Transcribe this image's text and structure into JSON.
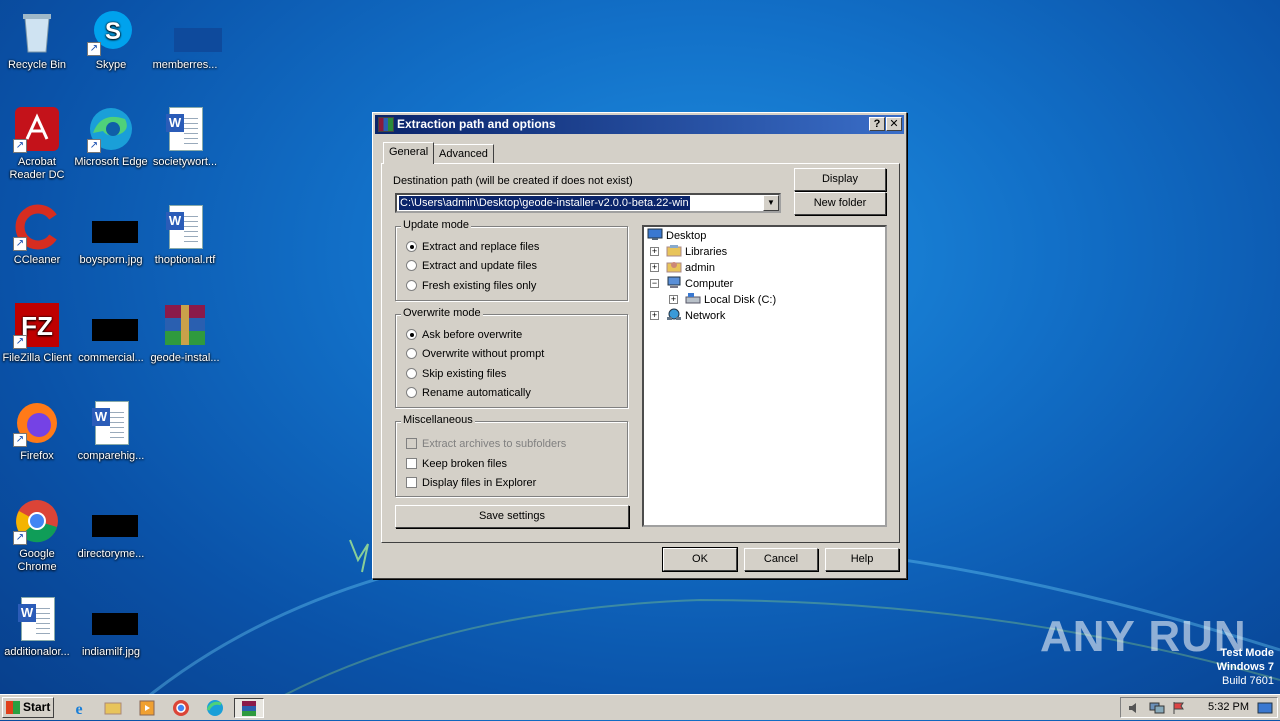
{
  "desktop": {
    "icons": [
      {
        "label": "Recycle Bin",
        "icon": "recycle-bin-icon"
      },
      {
        "label": "Skype",
        "icon": "skype-icon"
      },
      {
        "label": "memberres...",
        "icon": "file-icon"
      },
      {
        "label": "Acrobat Reader DC",
        "icon": "acrobat-icon"
      },
      {
        "label": "Microsoft Edge",
        "icon": "edge-icon"
      },
      {
        "label": "societywort...",
        "icon": "word-doc-icon"
      },
      {
        "label": "CCleaner",
        "icon": "ccleaner-icon"
      },
      {
        "label": "boysporn.jpg",
        "icon": "image-file-icon"
      },
      {
        "label": "thoptional.rtf",
        "icon": "word-doc-icon"
      },
      {
        "label": "FileZilla Client",
        "icon": "filezilla-icon"
      },
      {
        "label": "commercial...",
        "icon": "image-file-icon"
      },
      {
        "label": "geode-instal...",
        "icon": "winrar-icon"
      },
      {
        "label": "Firefox",
        "icon": "firefox-icon"
      },
      {
        "label": "comparehig...",
        "icon": "word-doc-icon"
      },
      {
        "label": "Google Chrome",
        "icon": "chrome-icon"
      },
      {
        "label": "directoryme...",
        "icon": "image-file-icon"
      },
      {
        "label": "additionalor...",
        "icon": "word-doc-icon"
      },
      {
        "label": "indiamilf.jpg",
        "icon": "image-file-icon"
      }
    ]
  },
  "dialog": {
    "title": "Extraction path and options",
    "help_btn": "?",
    "close_btn": "✕",
    "tabs": [
      "General",
      "Advanced"
    ],
    "destination_label": "Destination path (will be created if does not exist)",
    "destination_value": "C:\\Users\\admin\\Desktop\\geode-installer-v2.0.0-beta.22-win",
    "display_btn": "Display",
    "new_folder_btn": "New folder",
    "update_mode": {
      "title": "Update mode",
      "options": [
        "Extract and replace files",
        "Extract and update files",
        "Fresh existing files only"
      ],
      "selected": 0
    },
    "overwrite_mode": {
      "title": "Overwrite mode",
      "options": [
        "Ask before overwrite",
        "Overwrite without prompt",
        "Skip existing files",
        "Rename automatically"
      ],
      "selected": 0
    },
    "misc": {
      "title": "Miscellaneous",
      "options": [
        {
          "label": "Extract archives to subfolders",
          "checked": false,
          "disabled": true
        },
        {
          "label": "Keep broken files",
          "checked": false,
          "disabled": false
        },
        {
          "label": "Display files in Explorer",
          "checked": false,
          "disabled": false
        }
      ]
    },
    "save_settings_btn": "Save settings",
    "tree": [
      {
        "label": "Desktop",
        "icon": "desktop-icon",
        "expander": ""
      },
      {
        "label": "Libraries",
        "icon": "libraries-icon",
        "expander": "+"
      },
      {
        "label": "admin",
        "icon": "user-folder-icon",
        "expander": "+"
      },
      {
        "label": "Computer",
        "icon": "computer-icon",
        "expander": "−"
      },
      {
        "label": "Local Disk (C:)",
        "icon": "drive-icon",
        "expander": "+"
      },
      {
        "label": "Network",
        "icon": "network-icon",
        "expander": "+"
      }
    ],
    "ok_btn": "OK",
    "cancel_btn": "Cancel",
    "help_button": "Help"
  },
  "taskbar": {
    "start_label": "Start",
    "clock": "5:32 PM"
  },
  "watermark": {
    "line1": "Test Mode",
    "line2": "Windows 7",
    "line3": "Build 7601",
    "brand": "ANY RUN"
  }
}
